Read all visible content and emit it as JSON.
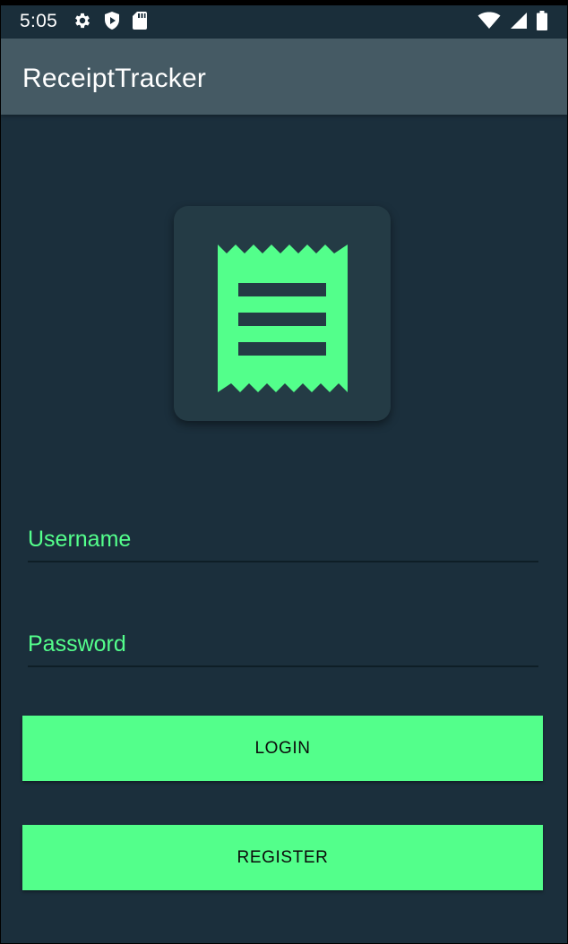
{
  "status_bar": {
    "time": "5:05",
    "icons_left": [
      "gear-icon",
      "shield-play-icon",
      "sd-card-icon"
    ],
    "icons_right": [
      "wifi-icon",
      "cell-signal-icon",
      "battery-icon"
    ]
  },
  "app_bar": {
    "title": "ReceiptTracker"
  },
  "logo": {
    "icon": "receipt-icon",
    "accent": "#53ff8b"
  },
  "form": {
    "username": {
      "placeholder": "Username",
      "value": ""
    },
    "password": {
      "placeholder": "Password",
      "value": ""
    }
  },
  "buttons": {
    "login_label": "LOGIN",
    "register_label": "REGISTER"
  },
  "colors": {
    "background": "#1b2f3c",
    "app_bar": "#455a64",
    "accent": "#53ff8b"
  }
}
